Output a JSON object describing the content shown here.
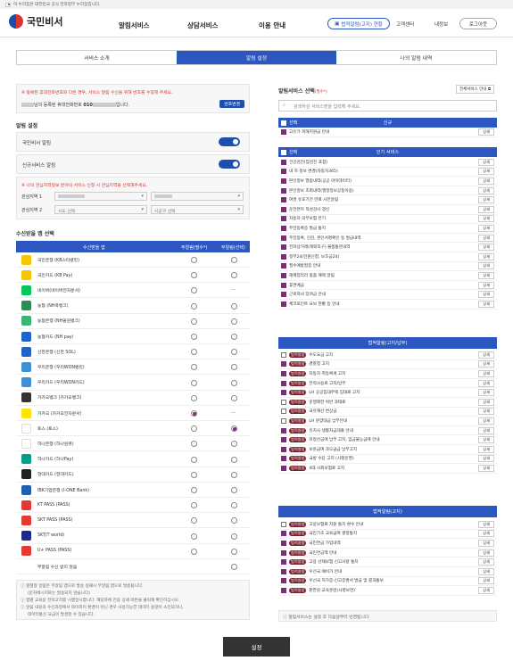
{
  "top_notice": "이 누리집은 대한민국 공식 전자정부 누리집입니다.",
  "brand": "국민비서",
  "nav": [
    "알림서비스",
    "상담서비스",
    "이용 안내"
  ],
  "header_actions": {
    "notice_btn": "법적알림(고지) 현황",
    "support": "고객센터",
    "myinfo": "내정보",
    "logout": "로그아웃"
  },
  "tabs": [
    "서비스 소개",
    "알림 설정",
    "나의 알림 내역"
  ],
  "phone_notice": {
    "warning": "※ 등록된 휴대전화번호와 다른 경우, 서비스 알림 수신을 위해 번호를 수정해 주세요.",
    "line_prefix": "님의 등록된 휴대전화번호",
    "phone_visible": "010",
    "line_suffix": "입니다.",
    "change_btn": "번호변경"
  },
  "settings": {
    "title": "알림 설정",
    "kookmin_label": "국민비서 알림",
    "new_service_label": "신규서비스 알림",
    "region_note": "※ 나의 관심지역정보 분야의 서비스 신청 시 관심지역을 선택해주세요.",
    "region1_label": "관심지역 1",
    "region2_label": "관심지역 2",
    "region2_sido": "시도 선택",
    "region2_sigungu": "시군구 선택"
  },
  "apps": {
    "title": "수신받을 앱 선택",
    "col_app": "수신받을 앱",
    "col_main": "주알림(필수*)",
    "col_sub": "부알림(선택)",
    "rows": [
      {
        "name": "국민은행 (KB스타뱅킹)",
        "main": false,
        "sub": "radio",
        "icon": "kb-icon",
        "color": "#f7c400"
      },
      {
        "name": "국민카드 (KB Pay)",
        "main": false,
        "sub": "radio",
        "icon": "kbpay-icon",
        "color": "#f7c400"
      },
      {
        "name": "네이버(네이버전자문서)",
        "main": false,
        "sub": "—",
        "icon": "naver-icon",
        "color": "#03c75a"
      },
      {
        "name": "농협 (NH콕뱅크)",
        "main": false,
        "sub": "radio",
        "icon": "nh-kok-icon",
        "color": "#2e8b57"
      },
      {
        "name": "농협은행 (NH올원뱅크)",
        "main": false,
        "sub": "radio",
        "icon": "nh-allone-icon",
        "color": "#3cb371"
      },
      {
        "name": "농협카드 (NH pay)",
        "main": false,
        "sub": "radio",
        "icon": "nhpay-icon",
        "color": "#1e63c9"
      },
      {
        "name": "신한은행 (신한 SOL)",
        "main": false,
        "sub": "radio",
        "icon": "shinhan-icon",
        "color": "#1e63c9"
      },
      {
        "name": "우리은행 (우리WON뱅킹)",
        "main": false,
        "sub": "radio",
        "icon": "woori-icon",
        "color": "#3d8fd6"
      },
      {
        "name": "우리카드 (우리WON카드)",
        "main": false,
        "sub": "radio",
        "icon": "wooricard-icon",
        "color": "#3d8fd6"
      },
      {
        "name": "카카오뱅크 (카카오뱅크)",
        "main": false,
        "sub": "radio",
        "icon": "kakaobank-icon",
        "color": "#333"
      },
      {
        "name": "카카오 (카카오전자문서)",
        "main": true,
        "sub": "—",
        "icon": "kakao-icon",
        "color": "#fee500"
      },
      {
        "name": "토스 (토스)",
        "main": false,
        "sub": "checked",
        "icon": "toss-icon",
        "color": "#ffffff"
      },
      {
        "name": "하나은행 (하나원큐)",
        "main": false,
        "sub": "radio",
        "icon": "hana-icon",
        "color": "#ffffff"
      },
      {
        "name": "하나카드 (하나Pay)",
        "main": false,
        "sub": "radio",
        "icon": "hanapay-icon",
        "color": "#009f8a"
      },
      {
        "name": "현대카드 (현대카드)",
        "main": false,
        "sub": "radio",
        "icon": "hyundai-icon",
        "color": "#222"
      },
      {
        "name": "IBK기업은행 (I-ONE Bank)",
        "main": false,
        "sub": "radio",
        "icon": "ibk-icon",
        "color": "#1e5fb4"
      },
      {
        "name": "KT PASS (PASS)",
        "main": false,
        "sub": "radio",
        "icon": "kt-pass-icon",
        "color": "#e53935"
      },
      {
        "name": "SKT PASS (PASS)",
        "main": false,
        "sub": "radio",
        "icon": "skt-pass-icon",
        "color": "#e53935"
      },
      {
        "name": "SKT(T world)",
        "main": false,
        "sub": "radio",
        "icon": "tworld-icon",
        "color": "#1b2b8c"
      },
      {
        "name": "U+ PASS (PASS)",
        "main": false,
        "sub": "radio",
        "icon": "uplus-pass-icon",
        "color": "#e53935"
      },
      {
        "name": "부알림 수신 받지 않음",
        "main": null,
        "sub": "radio",
        "icon": "",
        "color": ""
      }
    ]
  },
  "left_notes": [
    "ⓘ 결절형 알림은 주알림 앱으로 발송 실패시 부알림 앱으로 발송됩니다.",
    "(문자메시지로는 발송되지 않습니다)",
    "ⓘ 앱별 교육용 전자고지를 시행일시합니다. 해당자에 전용 상세 버튼을 클릭해 확인하십시오.",
    "ⓘ 알림 내용의 수신과정에서 와이파이 환경이 아닌 경우 사용가능한 데이터 용량이 소진되거나,",
    "데이터통신 요금이 발생할 수 있습니다."
  ],
  "services": {
    "title": "알림서비스 선택",
    "title_suffix": "(필수*)",
    "guide_btn": "전체서비스 안내",
    "search_placeholder": "검색하실 서비스명을 입력해 주세요.",
    "select_label": "선택",
    "new_label": "신규",
    "popular_label": "인기 서비스",
    "detail": "상세",
    "new_items": [
      {
        "name": "고유가 피해지원금 안내",
        "on": true
      }
    ],
    "popular_items": [
      {
        "name": "건강검진(암검진 포함)",
        "on": true
      },
      {
        "name": "내 차 정보 변경(자동차365)",
        "on": true
      },
      {
        "name": "본인정보 열람내역(공공 마이데이터)",
        "on": true
      },
      {
        "name": "본인정보 조회내역(행정정보공동이용)",
        "on": true
      },
      {
        "name": "여권 유효기간 만료 사전알림",
        "on": true
      },
      {
        "name": "운전면허 적성검사 갱신",
        "on": true
      },
      {
        "name": "자동차 의무보험 만기",
        "on": true
      },
      {
        "name": "주민등록증 발급 통지",
        "on": true
      },
      {
        "name": "주민등록, 인감, 본인서명확인 등 발급내역",
        "on": true
      },
      {
        "name": "전자상거래(해외직구) 물품통관내역",
        "on": true
      },
      {
        "name": "정부24(민원신청, 보조금24)",
        "on": true
      },
      {
        "name": "필수예방접종 안내",
        "on": true
      },
      {
        "name": "해제업리러 맞춤 혜택 알림",
        "on": true
      },
      {
        "name": "휴면예금",
        "on": true
      },
      {
        "name": "근로자녀 장려금 안내",
        "on": true
      },
      {
        "name": "체코포인트 요보 현황 등 안내",
        "on": true
      }
    ],
    "legal_nap_label": "법적알림(고지/납부)",
    "legal_nap_items": [
      {
        "name": "수도요금 고지",
        "on": false
      },
      {
        "name": "경찰청 고지",
        "on": true
      },
      {
        "name": "자동차 취등록세 고지",
        "on": true
      },
      {
        "name": "전력사용료 고지/납부",
        "on": true
      },
      {
        "name": "LH 공공임대주택 임대료 고지",
        "on": true
      },
      {
        "name": "운행제한 위반 과태료",
        "on": false
      },
      {
        "name": "국유재산 변상금",
        "on": false
      },
      {
        "name": "LH 분양대금 납부안내",
        "on": false
      },
      {
        "name": "유치사 생활자금대출 안내",
        "on": true
      },
      {
        "name": "미정산금에 납부 고지, 임금불능금에 안내",
        "on": true
      },
      {
        "name": "보훈급여 과오급금 납부고지",
        "on": true
      },
      {
        "name": "국방 수당 고지 (사행운영)",
        "on": true
      },
      {
        "name": "4대 사회보험료 고지",
        "on": true
      }
    ],
    "legal_label": "법적알림(고지)",
    "legal_items": [
      {
        "name": "고용보험료 지원 통지 환수 안내",
        "on": false
      },
      {
        "name": "국민기초 교육급여 결정통지",
        "on": true
      },
      {
        "name": "국민연금 가입내역",
        "on": true
      },
      {
        "name": "국민연금액 안내",
        "on": true
      },
      {
        "name": "고용 산재보험 신고사항 통지",
        "on": true
      },
      {
        "name": "우선국 예비가 안내",
        "on": true
      },
      {
        "name": "우선국 허가증·신고증명서 발급 및 결과통보",
        "on": true
      },
      {
        "name": "판한원 교육훈련(사병보연)",
        "on": true
      }
    ],
    "footer_note": "ⓘ 알림서비스는 설정 후 다음날부터 반영됩니다."
  },
  "submit": "설정"
}
